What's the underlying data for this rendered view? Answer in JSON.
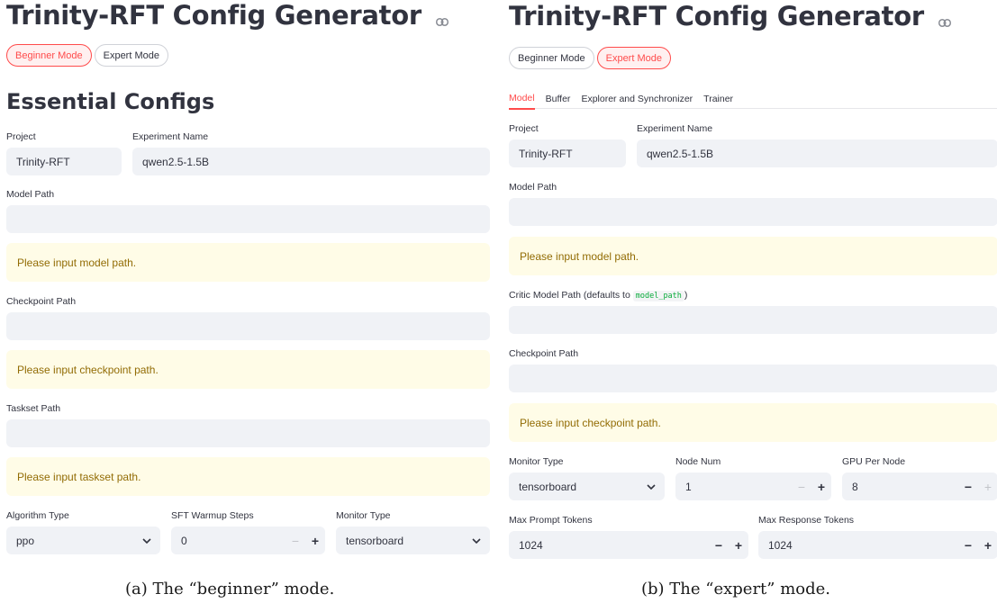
{
  "panel_a": {
    "title": "Trinity-RFT Config Generator",
    "modes": {
      "beginner": "Beginner Mode",
      "expert": "Expert Mode"
    },
    "section_title": "Essential Configs",
    "project_label": "Project",
    "project_value": "Trinity-RFT",
    "experiment_label": "Experiment Name",
    "experiment_value": "qwen2.5-1.5B",
    "model_path_label": "Model Path",
    "model_path_warning": "Please input model path.",
    "checkpoint_label": "Checkpoint Path",
    "checkpoint_warning": "Please input checkpoint path.",
    "taskset_label": "Taskset Path",
    "taskset_warning": "Please input taskset path.",
    "algorithm_label": "Algorithm Type",
    "algorithm_value": "ppo",
    "sft_label": "SFT Warmup Steps",
    "sft_value": "0",
    "monitor_label": "Monitor Type",
    "monitor_value": "tensorboard"
  },
  "panel_b": {
    "title": "Trinity-RFT Config Generator",
    "modes": {
      "beginner": "Beginner Mode",
      "expert": "Expert Mode"
    },
    "tabs": [
      "Model",
      "Buffer",
      "Explorer and Synchronizer",
      "Trainer"
    ],
    "project_label": "Project",
    "project_value": "Trinity-RFT",
    "experiment_label": "Experiment Name",
    "experiment_value": "qwen2.5-1.5B",
    "model_path_label": "Model Path",
    "model_path_warning": "Please input model path.",
    "critic_label": "Critic Model Path (defaults to ",
    "critic_code": "model_path",
    "critic_label_end": ")",
    "checkpoint_label": "Checkpoint Path",
    "checkpoint_warning": "Please input checkpoint path.",
    "monitor_label": "Monitor Type",
    "monitor_value": "tensorboard",
    "node_label": "Node Num",
    "node_value": "1",
    "gpu_label": "GPU Per Node",
    "gpu_value": "8",
    "prompt_label": "Max Prompt Tokens",
    "prompt_value": "1024",
    "response_label": "Max Response Tokens",
    "response_value": "1024"
  },
  "captions": {
    "a": "(a) The “beginner” mode.",
    "b": "(b) The “expert” mode."
  },
  "icons": {
    "link": "link-icon",
    "chevron": "chevron-down-icon",
    "minus": "−",
    "plus": "+"
  },
  "colors": {
    "accent": "#ff4b4b",
    "warning_bg": "#fffce7",
    "warning_text": "#926c05",
    "field_bg": "#f0f2f6"
  }
}
